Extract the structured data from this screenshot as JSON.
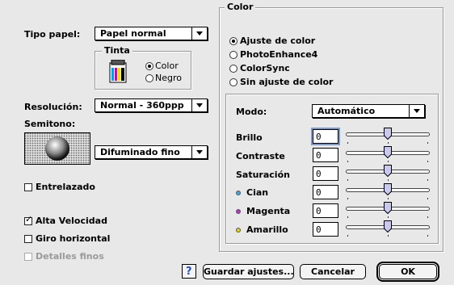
{
  "paper": {
    "label": "Tipo papel:",
    "value": "Papel normal"
  },
  "ink": {
    "title": "Tinta",
    "options": [
      {
        "label": "Color",
        "selected": true
      },
      {
        "label": "Negro",
        "selected": false
      }
    ]
  },
  "resolution": {
    "label": "Resolución:",
    "value": "Normal - 360ppp"
  },
  "halftone": {
    "label": "Semitono:",
    "value": "Difuminado fino"
  },
  "checkboxes": [
    {
      "label": "Entrelazado",
      "checked": false,
      "enabled": true
    },
    {
      "label": "Alta Velocidad",
      "checked": true,
      "enabled": true
    },
    {
      "label": "Giro horizontal",
      "checked": false,
      "enabled": true
    },
    {
      "label": "Detalles finos",
      "checked": false,
      "enabled": false
    }
  ],
  "color": {
    "title": "Color",
    "options": [
      {
        "label": "Ajuste de color",
        "selected": true
      },
      {
        "label": "PhotoEnhance4",
        "selected": false
      },
      {
        "label": "ColorSync",
        "selected": false
      },
      {
        "label": "Sin ajuste de color",
        "selected": false
      }
    ],
    "mode_label": "Modo:",
    "mode_value": "Automático",
    "adjustments": [
      {
        "label": "Brillo",
        "value": "0",
        "dot": ""
      },
      {
        "label": "Contraste",
        "value": "0",
        "dot": ""
      },
      {
        "label": "Saturación",
        "value": "0",
        "dot": ""
      },
      {
        "label": "Cian",
        "value": "0",
        "dot": "#3fa9e0"
      },
      {
        "label": "Magenta",
        "value": "0",
        "dot": "#c030c8"
      },
      {
        "label": "Amarillo",
        "value": "0",
        "dot": "#e6d400"
      }
    ]
  },
  "buttons": {
    "help": "?",
    "save": "Guardar ajustes...",
    "cancel": "Cancelar",
    "ok": "OK"
  },
  "icons": {
    "ink": "ink-cartridge-icon",
    "halftone": "halftone-sphere-icon"
  },
  "colors": {
    "background": "#e8e8e8",
    "focus": "#7d9ac6",
    "help_blue": "#1f4fd1"
  }
}
